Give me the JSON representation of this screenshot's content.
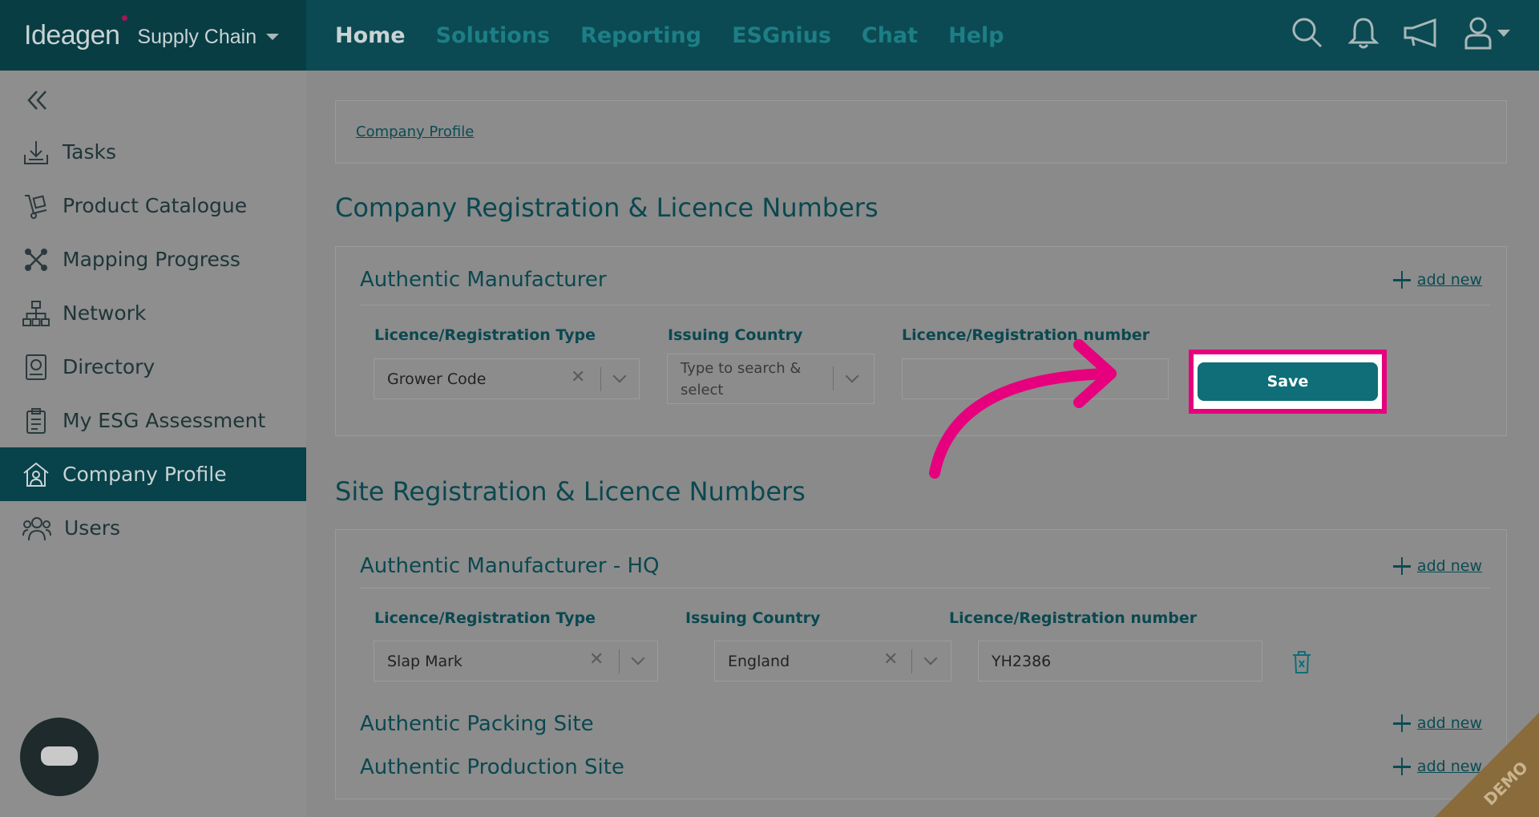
{
  "brand": {
    "logo": "Ideagen",
    "product": "Supply Chain"
  },
  "nav": {
    "items": [
      "Home",
      "Solutions",
      "Reporting",
      "ESGnius",
      "Chat",
      "Help"
    ]
  },
  "sidebar": {
    "items": [
      {
        "label": "Tasks",
        "icon": "download-tray-icon"
      },
      {
        "label": "Product Catalogue",
        "icon": "hand-truck-icon"
      },
      {
        "label": "Mapping Progress",
        "icon": "network-cross-icon"
      },
      {
        "label": "Network",
        "icon": "hierarchy-icon"
      },
      {
        "label": "Directory",
        "icon": "directory-book-icon"
      },
      {
        "label": "My ESG Assessment",
        "icon": "clipboard-icon"
      },
      {
        "label": "Company Profile",
        "icon": "house-person-icon"
      },
      {
        "label": "Users",
        "icon": "users-icon"
      }
    ],
    "active": "Company Profile"
  },
  "breadcrumb": "Company Profile",
  "company_section": {
    "title": "Company Registration & Licence Numbers",
    "panel_title": "Authentic Manufacturer",
    "add_new": "add new",
    "labels": {
      "type": "Licence/Registration Type",
      "country": "Issuing Country",
      "number": "Licence/Registration number"
    },
    "type_value": "Grower Code",
    "country_placeholder": "Type to search & select",
    "country_placeholder_line1": "Type to search &",
    "country_placeholder_line2": "select",
    "number_value": "",
    "save": "Save"
  },
  "site_section": {
    "title": "Site Registration & Licence Numbers",
    "panel_title": "Authentic Manufacturer - HQ",
    "add_new": "add new",
    "labels": {
      "type": "Licence/Registration Type",
      "country": "Issuing Country",
      "number": "Licence/Registration number"
    },
    "type_value": "Slap Mark",
    "country_value": "England",
    "number_value": "YH2386",
    "sub_sites": [
      {
        "title": "Authentic Packing Site",
        "add_new": "add new"
      },
      {
        "title": "Authentic Production Site",
        "add_new": "add new"
      }
    ]
  },
  "watermark": "DEMO",
  "colors": {
    "topbar": "#0b4a52",
    "accent": "#0f6e77",
    "highlight": "#e6007e"
  }
}
